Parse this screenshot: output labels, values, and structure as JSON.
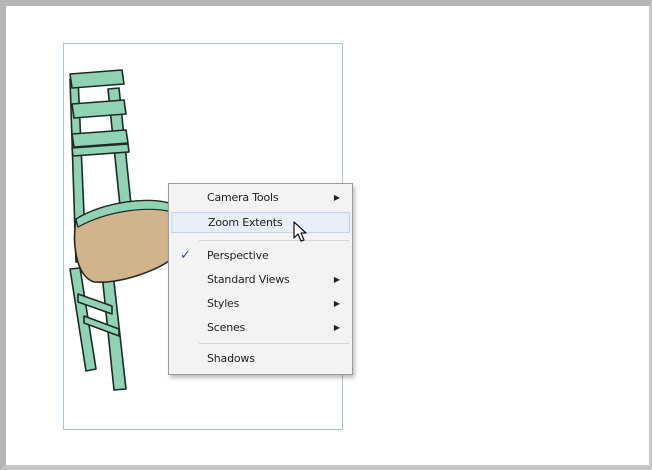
{
  "colors": {
    "chair_frame": "#8fd3b4",
    "chair_seat": "#d2b48c",
    "menu_background": "#f3f3f3",
    "menu_highlight": "#e6eef8",
    "viewport_border": "#a9c3d8"
  },
  "icons": {
    "cursor": "arrow-pointer-icon",
    "submenu": "submenu-arrow-icon",
    "check": "checkmark-icon"
  },
  "context_menu": {
    "items": [
      {
        "label": "Camera Tools",
        "has_submenu": true,
        "checked": false,
        "highlighted": false
      },
      {
        "label": "Zoom Extents",
        "has_submenu": false,
        "checked": false,
        "highlighted": true
      },
      {
        "label": "Perspective",
        "has_submenu": false,
        "checked": true,
        "highlighted": false
      },
      {
        "label": "Standard Views",
        "has_submenu": true,
        "checked": false,
        "highlighted": false
      },
      {
        "label": "Styles",
        "has_submenu": true,
        "checked": false,
        "highlighted": false
      },
      {
        "label": "Scenes",
        "has_submenu": true,
        "checked": false,
        "highlighted": false
      },
      {
        "label": "Shadows",
        "has_submenu": false,
        "checked": false,
        "highlighted": false
      }
    ],
    "check_glyph": "✓",
    "arrow_glyph": "▶"
  }
}
